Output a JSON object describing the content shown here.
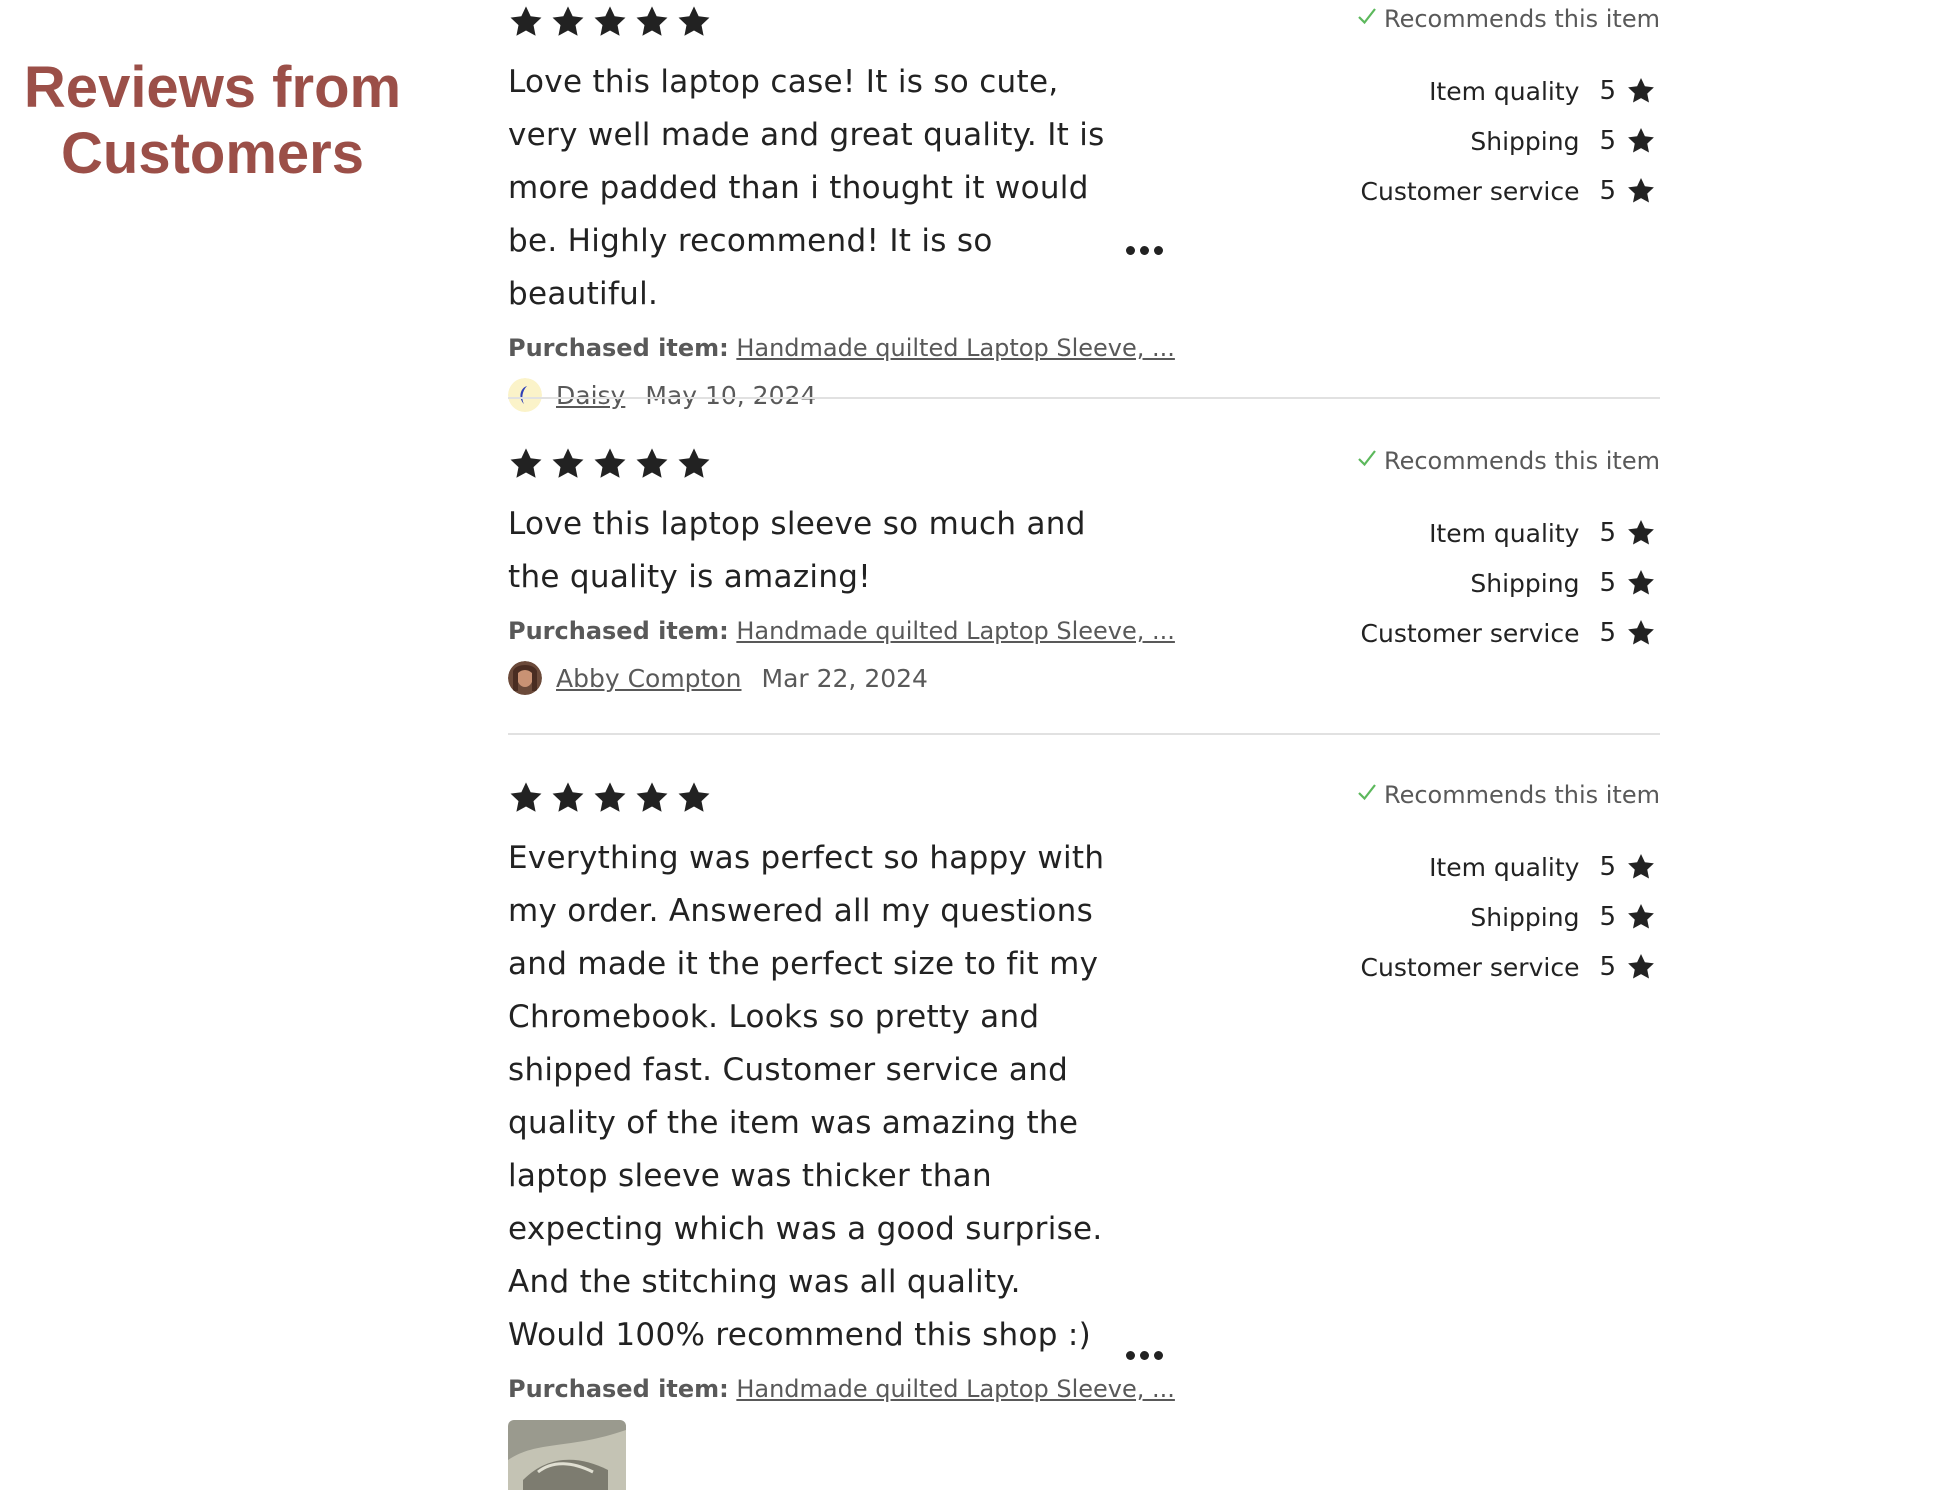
{
  "section_title": {
    "line1": "Reviews from",
    "line2": "Customers",
    "color": "#9b4f48"
  },
  "reviews": [
    {
      "rating": 5,
      "text": "Love this laptop case! It is so cute, very well made and great quality. It is more padded than i thought it would be. Highly recommend! It is so beautiful.",
      "has_more": true,
      "purchased_label": "Purchased item:",
      "purchased_item": "Handmade quilted Laptop Sleeve, ...",
      "reviewer": "Daisy",
      "date": "May 10, 2024",
      "recommends": "Recommends this item",
      "ratings": [
        {
          "label": "Item quality",
          "value": "5"
        },
        {
          "label": "Shipping",
          "value": "5"
        },
        {
          "label": "Customer service",
          "value": "5"
        }
      ]
    },
    {
      "rating": 5,
      "text": "Love this laptop sleeve so much and the quality is amazing!",
      "has_more": false,
      "purchased_label": "Purchased item:",
      "purchased_item": "Handmade quilted Laptop Sleeve, ...",
      "reviewer": "Abby Compton",
      "date": "Mar 22, 2024",
      "recommends": "Recommends this item",
      "ratings": [
        {
          "label": "Item quality",
          "value": "5"
        },
        {
          "label": "Shipping",
          "value": "5"
        },
        {
          "label": "Customer service",
          "value": "5"
        }
      ]
    },
    {
      "rating": 5,
      "text": "Everything was perfect so happy with my order. Answered all my questions and made it the perfect size to fit my Chromebook. Looks so pretty and shipped fast. Customer service and quality of the item was amazing the laptop sleeve was thicker than expecting which was a good surprise. And the stitching was all quality. Would 100% recommend this shop :)",
      "has_more": true,
      "purchased_label": "Purchased item:",
      "purchased_item": "Handmade quilted Laptop Sleeve, ...",
      "recommends": "Recommends this item",
      "ratings": [
        {
          "label": "Item quality",
          "value": "5"
        },
        {
          "label": "Shipping",
          "value": "5"
        },
        {
          "label": "Customer service",
          "value": "5"
        }
      ]
    }
  ],
  "colors": {
    "star": "#222222",
    "check": "#5cb85c",
    "muted_text": "#595959",
    "divider": "#e1e1e1"
  },
  "icons": {
    "star": "star-icon",
    "check": "checkmark-icon",
    "more": "more-options-icon"
  }
}
